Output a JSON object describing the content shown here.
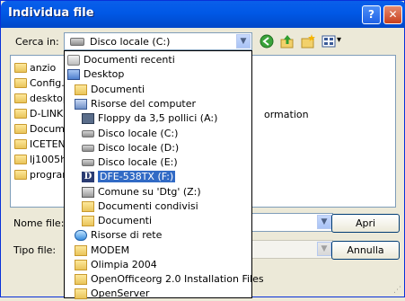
{
  "window": {
    "title": "Individua file",
    "help_label": "?",
    "close_label": "✕"
  },
  "lookin": {
    "label": "Cerca in:",
    "value": "Disco locale (C:)",
    "arrow": "▼"
  },
  "toolbar": {
    "back": "back-icon",
    "up": "up-folder-icon",
    "newfolder": "new-folder-icon",
    "view": "view-menu-icon",
    "view_arrow": "▾"
  },
  "files": [
    {
      "label": "anzio"
    },
    {
      "label": "Config.M"
    },
    {
      "label": "desktop"
    },
    {
      "label": "D-LINK"
    },
    {
      "label": "Docume"
    },
    {
      "label": "ICETEN"
    },
    {
      "label": "lj1005hb"
    },
    {
      "label": "program"
    }
  ],
  "files_extra": "ormation",
  "dropdown": [
    {
      "label": "Documenti recenti",
      "icon": "recent"
    },
    {
      "label": "Desktop",
      "icon": "desktop"
    },
    {
      "label": "Documenti",
      "icon": "docs"
    },
    {
      "label": "Risorse del computer",
      "icon": "computer"
    },
    {
      "label": "Floppy da 3,5 pollici (A:)",
      "icon": "floppy"
    },
    {
      "label": "Disco locale (C:)",
      "icon": "drive"
    },
    {
      "label": "Disco locale (D:)",
      "icon": "drive"
    },
    {
      "label": "Disco locale (E:)",
      "icon": "drive"
    },
    {
      "label": "DFE-538TX (F:)",
      "icon": "dfe",
      "selected": true
    },
    {
      "label": "Comune su 'Dtg' (Z:)",
      "icon": "share"
    },
    {
      "label": "Documenti condivisi",
      "icon": "folder"
    },
    {
      "label": "Documenti",
      "icon": "folder"
    },
    {
      "label": "Risorse di rete",
      "icon": "network"
    },
    {
      "label": "MODEM",
      "icon": "folder"
    },
    {
      "label": "Olimpia 2004",
      "icon": "folder"
    },
    {
      "label": "OpenOfficeorg 2.0 Installation Files",
      "icon": "folder"
    },
    {
      "label": "OpenServer",
      "icon": "folder"
    }
  ],
  "filename": {
    "label": "Nome file:",
    "value": "",
    "arrow": "▼"
  },
  "filetype": {
    "label": "Tipo file:",
    "value": "",
    "arrow": "▼"
  },
  "buttons": {
    "open": "Apri",
    "cancel": "Annulla"
  }
}
